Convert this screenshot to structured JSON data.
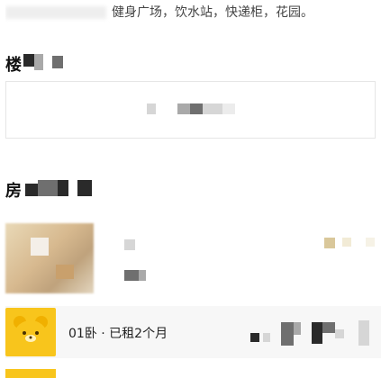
{
  "facilities": {
    "text_visible": "健身广场，饮水站，快递柜，花园。"
  },
  "sections": {
    "building_title": "楼",
    "room_title": "房"
  },
  "tenant": {
    "label": "01卧 · 已租2个月"
  },
  "colors": {
    "accent_yellow": "#f8c51c",
    "row_bg": "#f7f7f7"
  },
  "icons": {
    "tenant_avatar": "bear-face-icon"
  }
}
